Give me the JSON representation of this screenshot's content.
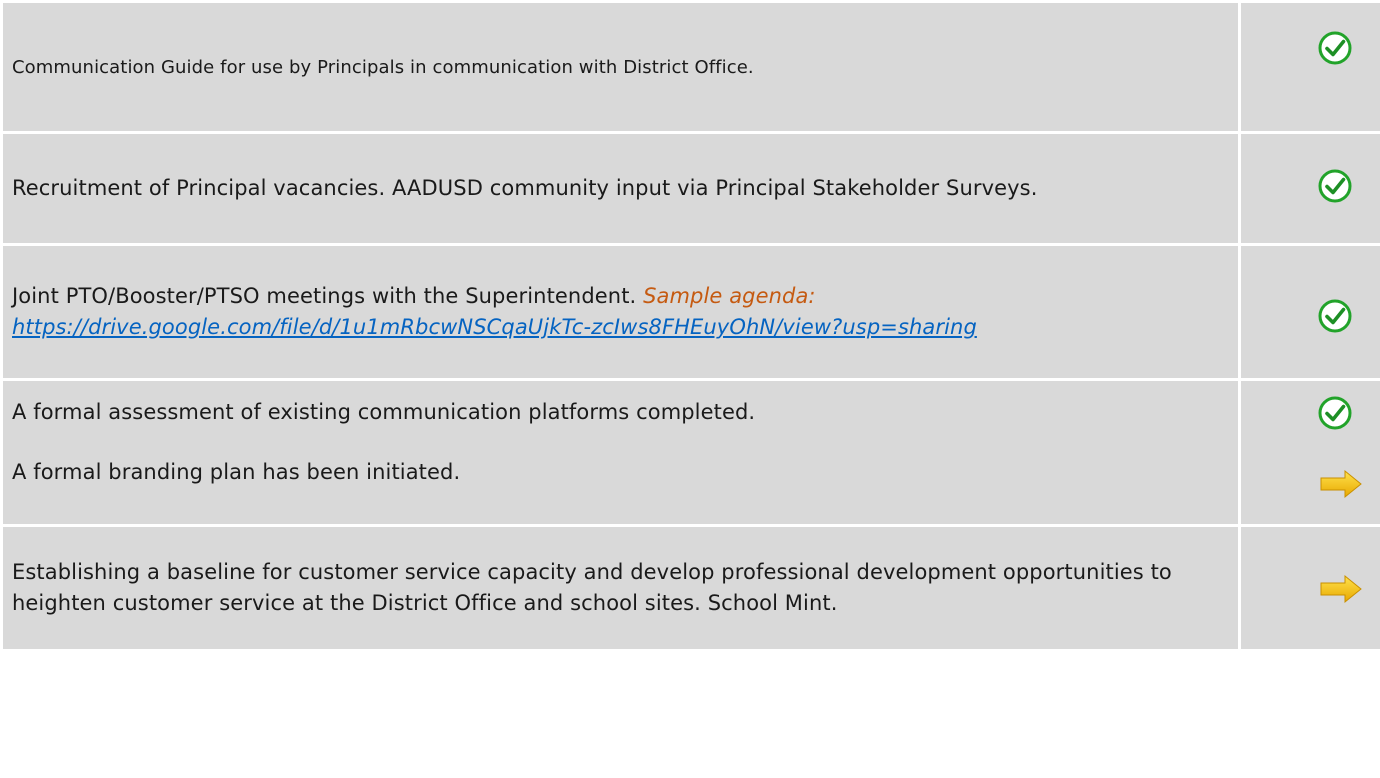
{
  "rows": [
    {
      "text": "Communication Guide for use by Principals in communication with District Office.",
      "status": [
        "check-icon"
      ]
    },
    {
      "text": "Recruitment of Principal vacancies.  AADUSD community input via Principal Stakeholder Surveys.",
      "status": [
        "check-icon"
      ]
    },
    {
      "text": "Joint PTO/Booster/PTSO meetings with the Superintendent. ",
      "sample_label": "Sample agenda:",
      "link": "https://drive.google.com/file/d/1u1mRbcwNSCqaUjkTc-zcIws8FHEuyOhN/view?usp=sharing",
      "status": [
        "check-icon"
      ]
    },
    {
      "text": "A formal assessment of existing communication platforms completed.",
      "text2": "A formal branding plan has been initiated.",
      "status": [
        "check-icon",
        "arrow-right-icon"
      ]
    },
    {
      "text": "Establishing a baseline for customer service capacity and develop professional development opportunities to heighten customer service at the District Office and school sites.  School Mint.",
      "status": [
        "arrow-right-icon"
      ]
    }
  ],
  "colors": {
    "cell_background": "#d9d9d9",
    "check_green": "#22a32a",
    "arrow_yellow": "#f5c400",
    "sample_label": "#c55a11",
    "link": "#0563c1"
  }
}
